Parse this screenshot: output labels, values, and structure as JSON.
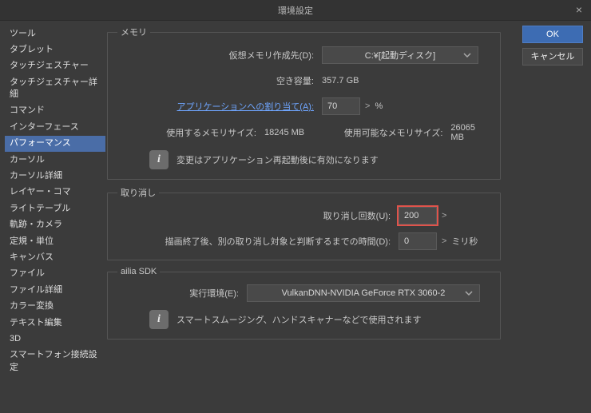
{
  "window": {
    "title": "環境設定"
  },
  "actions": {
    "ok": "OK",
    "cancel": "キャンセル"
  },
  "sidebar": {
    "items": [
      {
        "label": "ツール"
      },
      {
        "label": "タブレット"
      },
      {
        "label": "タッチジェスチャー"
      },
      {
        "label": "タッチジェスチャー詳細"
      },
      {
        "label": "コマンド"
      },
      {
        "label": "インターフェース"
      },
      {
        "label": "パフォーマンス"
      },
      {
        "label": "カーソル"
      },
      {
        "label": "カーソル詳細"
      },
      {
        "label": "レイヤー・コマ"
      },
      {
        "label": "ライトテーブル"
      },
      {
        "label": "軌跡・カメラ"
      },
      {
        "label": "定規・単位"
      },
      {
        "label": "キャンバス"
      },
      {
        "label": "ファイル"
      },
      {
        "label": "ファイル詳細"
      },
      {
        "label": "カラー変換"
      },
      {
        "label": "テキスト編集"
      },
      {
        "label": "3D"
      },
      {
        "label": "スマートフォン接続設定"
      }
    ],
    "selected_index": 6
  },
  "memory": {
    "legend": "メモリ",
    "virt_label": "仮想メモリ作成先(D):",
    "virt_value": "C:¥[起動ディスク]",
    "free_label": "空き容量:",
    "free_value": "357.7 GB",
    "alloc_link": "アプリケーションへの割り当て(A):",
    "alloc_value": "70",
    "alloc_unit": "%",
    "used_label": "使用するメモリサイズ:",
    "used_value": "18245 MB",
    "avail_label": "使用可能なメモリサイズ:",
    "avail_value": "26065 MB",
    "info": "変更はアプリケーション再起動後に有効になります"
  },
  "undo": {
    "legend": "取り消し",
    "count_label": "取り消し回数(U):",
    "count_value": "200",
    "delay_label": "描画終了後、別の取り消し対象と判断するまでの時間(D):",
    "delay_value": "0",
    "delay_unit": "ミリ秒"
  },
  "sdk": {
    "legend": "ailia SDK",
    "env_label": "実行環境(E):",
    "env_value": "VulkanDNN-NVIDIA GeForce RTX 3060-2",
    "info": "スマートスムージング、ハンドスキャナーなどで使用されます"
  }
}
